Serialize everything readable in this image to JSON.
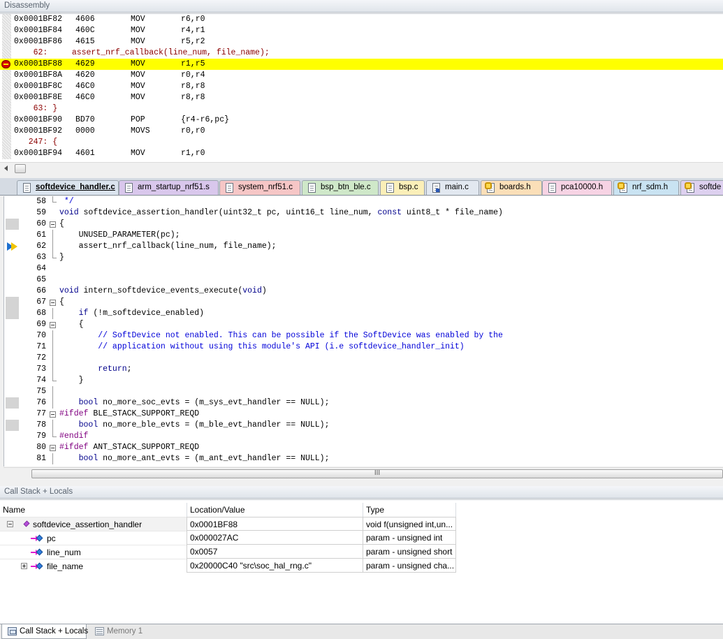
{
  "disassembly": {
    "title": "Disassembly",
    "rows": [
      {
        "kind": "ins",
        "addr": "0x0001BF82",
        "op": "4606",
        "mn": "MOV",
        "arg": "r6,r0"
      },
      {
        "kind": "ins",
        "addr": "0x0001BF84",
        "op": "460C",
        "mn": "MOV",
        "arg": "r4,r1"
      },
      {
        "kind": "ins",
        "addr": "0x0001BF86",
        "op": "4615",
        "mn": "MOV",
        "arg": "r5,r2"
      },
      {
        "kind": "src",
        "text": "    62:     assert_nrf_callback(line_num, file_name);"
      },
      {
        "kind": "ins",
        "addr": "0x0001BF88",
        "op": "4629",
        "mn": "MOV",
        "arg": "r1,r5",
        "current": true
      },
      {
        "kind": "ins",
        "addr": "0x0001BF8A",
        "op": "4620",
        "mn": "MOV",
        "arg": "r0,r4"
      },
      {
        "kind": "ins",
        "addr": "0x0001BF8C",
        "op": "46C0",
        "mn": "MOV",
        "arg": "r8,r8"
      },
      {
        "kind": "ins",
        "addr": "0x0001BF8E",
        "op": "46C0",
        "mn": "MOV",
        "arg": "r8,r8"
      },
      {
        "kind": "src",
        "text": "    63: }"
      },
      {
        "kind": "ins",
        "addr": "0x0001BF90",
        "op": "BD70",
        "mn": "POP",
        "arg": "{r4-r6,pc}"
      },
      {
        "kind": "ins",
        "addr": "0x0001BF92",
        "op": "0000",
        "mn": "MOVS",
        "arg": "r0,r0"
      },
      {
        "kind": "src",
        "text": "   247: {"
      },
      {
        "kind": "ins",
        "addr": "0x0001BF94",
        "op": "4601",
        "mn": "MOV",
        "arg": "r1,r0"
      }
    ]
  },
  "tabs": [
    {
      "label": "softdevice_handler.c",
      "color": "#dbe4ee",
      "icon": "file",
      "active": true
    },
    {
      "label": "arm_startup_nrf51.s",
      "color": "#d9c7ec",
      "icon": "file"
    },
    {
      "label": "system_nrf51.c",
      "color": "#f6c6c6",
      "icon": "file"
    },
    {
      "label": "bsp_btn_ble.c",
      "color": "#cfe8c9",
      "icon": "file"
    },
    {
      "label": "bsp.c",
      "color": "#fbefb8",
      "icon": "file"
    },
    {
      "label": "main.c",
      "color": "#e2e8f0",
      "icon": "cfg"
    },
    {
      "label": "boards.h",
      "color": "#fbdfb8",
      "icon": "key"
    },
    {
      "label": "pca10000.h",
      "color": "#f7d3e4",
      "icon": "file"
    },
    {
      "label": "nrf_sdm.h",
      "color": "#c9e3f2",
      "icon": "key"
    },
    {
      "label": "softde",
      "color": "#ddd0ef",
      "icon": "key"
    }
  ],
  "editor": {
    "lines": [
      {
        "n": "58",
        "fold": "end",
        "html": " */",
        "cls": "cm"
      },
      {
        "n": "59",
        "html": "<span class=\"kw\">void</span> softdevice_assertion_handler(uint32_t pc, uint16_t line_num, <span class=\"kw\">const</span> uint8_t * file_name)"
      },
      {
        "n": "60",
        "fold": "box",
        "mark": true,
        "html": "{"
      },
      {
        "n": "61",
        "fold": "line",
        "html": "    UNUSED_PARAMETER(pc);"
      },
      {
        "n": "62",
        "fold": "line",
        "cursor": true,
        "html": "    assert_nrf_callback(line_num, file_name);"
      },
      {
        "n": "63",
        "fold": "end",
        "html": "}"
      },
      {
        "n": "64",
        "html": ""
      },
      {
        "n": "65",
        "html": ""
      },
      {
        "n": "66",
        "html": "<span class=\"kw\">void</span> intern_softdevice_events_execute(<span class=\"kw\">void</span>)"
      },
      {
        "n": "67",
        "fold": "box",
        "mark": true,
        "html": "{"
      },
      {
        "n": "68",
        "fold": "line",
        "mark": true,
        "html": "    <span class=\"kw\">if</span> (!m_softdevice_enabled)"
      },
      {
        "n": "69",
        "fold": "box",
        "html": "    {"
      },
      {
        "n": "70",
        "fold": "line",
        "html": "        <span class=\"cm\">// SoftDevice not enabled. This can be possible if the SoftDevice was enabled by the</span>"
      },
      {
        "n": "71",
        "fold": "line",
        "html": "        <span class=\"cm\">// application without using this module's API (i.e softdevice_handler_init)</span>"
      },
      {
        "n": "72",
        "fold": "line",
        "html": ""
      },
      {
        "n": "73",
        "fold": "line",
        "html": "        <span class=\"kw\">return</span>;"
      },
      {
        "n": "74",
        "fold": "end",
        "html": "    }"
      },
      {
        "n": "75",
        "fold": "line",
        "html": ""
      },
      {
        "n": "76",
        "fold": "line",
        "mark": true,
        "html": "    <span class=\"kw\">bool</span> no_more_soc_evts = (m_sys_evt_handler == NULL);"
      },
      {
        "n": "77",
        "fold": "box",
        "html": "<span class=\"pp\">#ifdef</span> BLE_STACK_SUPPORT_REQD"
      },
      {
        "n": "78",
        "fold": "line",
        "mark": true,
        "html": "    <span class=\"kw\">bool</span> no_more_ble_evts = (m_ble_evt_handler == NULL);"
      },
      {
        "n": "79",
        "fold": "end",
        "html": "<span class=\"pp\">#endif</span>"
      },
      {
        "n": "80",
        "fold": "box",
        "html": "<span class=\"pp\">#ifdef</span> ANT_STACK_SUPPORT_REQD"
      },
      {
        "n": "81",
        "fold": "line",
        "html": "    <span class=\"kw\">bool</span> no_more_ant_evts = (m_ant_evt_handler == NULL);"
      }
    ],
    "scroll_grip": "III"
  },
  "callstack": {
    "title": "Call Stack + Locals",
    "headers": [
      "Name",
      "Location/Value",
      "Type"
    ],
    "rows": [
      {
        "level": 0,
        "toggle": "minus",
        "icon": "function",
        "name": "softdevice_assertion_handler",
        "value": "0x0001BF88",
        "type": "void f(unsigned int,un..."
      },
      {
        "level": 1,
        "icon": "param",
        "name": "pc",
        "value": "0x000027AC",
        "type": "param - unsigned int"
      },
      {
        "level": 1,
        "icon": "param",
        "name": "line_num",
        "value": "0x0057",
        "type": "param - unsigned short"
      },
      {
        "level": 1,
        "toggle": "plus",
        "icon": "param",
        "name": "file_name",
        "value": "0x20000C40 \"src\\soc_hal_rng.c\"",
        "type": "param - unsigned cha..."
      }
    ]
  },
  "bottom_tabs": [
    {
      "label": "Call Stack + Locals",
      "icon": "stack-icon",
      "active": true
    },
    {
      "label": "Memory 1",
      "icon": "memory-icon",
      "active": false
    }
  ]
}
